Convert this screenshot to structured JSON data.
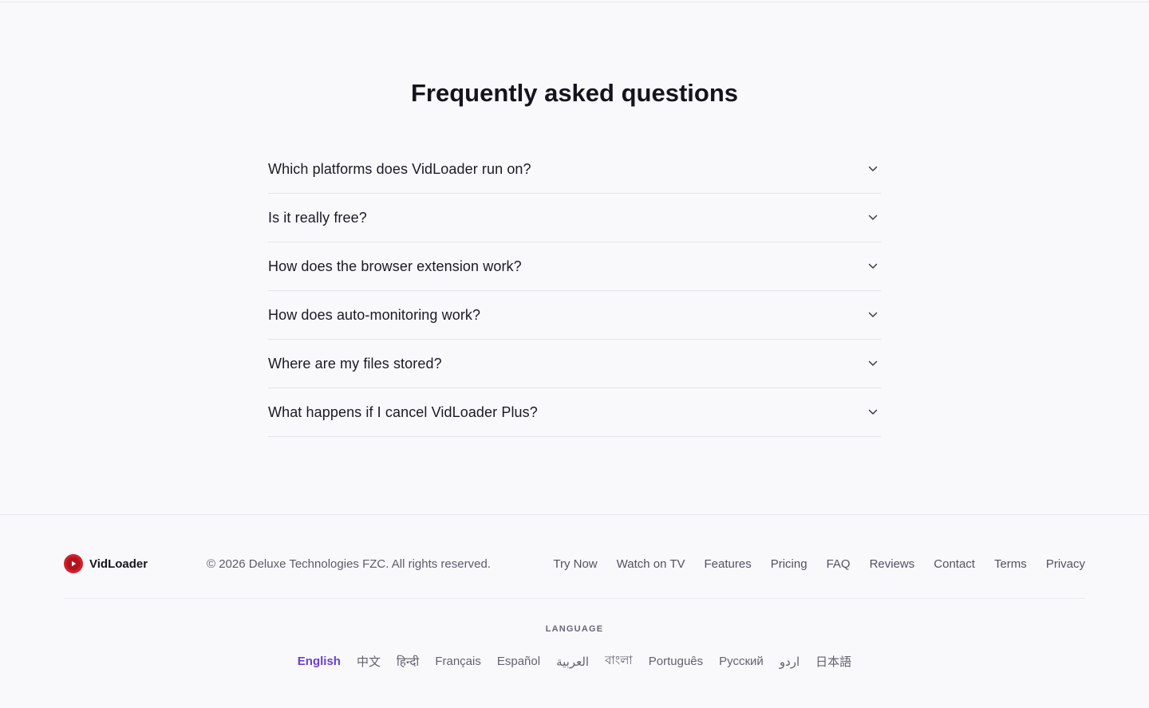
{
  "faq": {
    "title": "Frequently asked questions",
    "items": [
      {
        "question": "Which platforms does VidLoader run on?"
      },
      {
        "question": "Is it really free?"
      },
      {
        "question": "How does the browser extension work?"
      },
      {
        "question": "How does auto-monitoring work?"
      },
      {
        "question": "Where are my files stored?"
      },
      {
        "question": "What happens if I cancel VidLoader Plus?"
      }
    ],
    "expand_icon": "chevron-down-icon"
  },
  "footer": {
    "brand": {
      "name": "VidLoader",
      "logo_icon": "play-logo-icon",
      "logo_color": "#d1202a"
    },
    "copyright": "© 2026 Deluxe Technologies FZC. All rights reserved.",
    "links": [
      "Try Now",
      "Watch on TV",
      "Features",
      "Pricing",
      "FAQ",
      "Reviews",
      "Contact",
      "Terms",
      "Privacy"
    ],
    "language": {
      "heading": "LANGUAGE",
      "options": [
        "English",
        "中文",
        "हिन्दी",
        "Français",
        "Español",
        "العربية",
        "বাংলা",
        "Português",
        "Русский",
        "اردو",
        "日本語"
      ],
      "selected": "English",
      "accent_color": "#6a3fd1"
    }
  }
}
